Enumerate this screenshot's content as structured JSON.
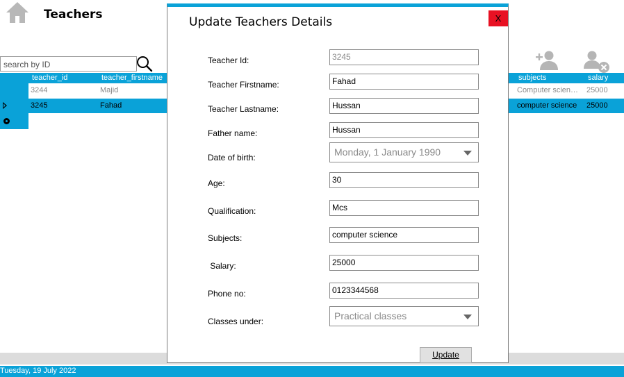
{
  "header": {
    "title": "Teachers",
    "home_icon": "home-icon"
  },
  "search": {
    "placeholder": "search by ID",
    "icon": "search-icon"
  },
  "toolbar": {
    "add_icon": "add-user-icon",
    "remove_icon": "remove-user-icon"
  },
  "grid": {
    "columns": {
      "teacher_id": "teacher_id",
      "teacher_firstname": "teacher_firstname",
      "subjects": "subjects",
      "salary": "salary"
    },
    "rows": [
      {
        "teacher_id": "3244",
        "teacher_firstname": "Majid",
        "subjects": "Computer scien…",
        "salary": "25000"
      },
      {
        "teacher_id": "3245",
        "teacher_firstname": "Fahad",
        "subjects": "computer science",
        "salary": "25000"
      }
    ]
  },
  "status_bar": {
    "date": "Tuesday, 19 July 2022"
  },
  "dialog": {
    "title": "Update Teachers Details",
    "close_label": "X",
    "fields": {
      "teacher_id": {
        "label": "Teacher Id:",
        "value": "3245"
      },
      "first_name": {
        "label": "Teacher Firstname:",
        "value": "Fahad"
      },
      "last_name": {
        "label": "Teacher Lastname:",
        "value": "Hussan"
      },
      "father_name": {
        "label": "Father name:",
        "value": "Hussan"
      },
      "dob": {
        "label": "Date of birth:",
        "value": "Monday, 1 January 1990"
      },
      "age": {
        "label": "Age:",
        "value": "30"
      },
      "qualification": {
        "label": "Qualification:",
        "value": "Mcs"
      },
      "subjects": {
        "label": "Subjects:",
        "value": "computer science"
      },
      "salary": {
        "label": " Salary:",
        "value": "25000"
      },
      "phone": {
        "label": "Phone no:",
        "value": "0123344568"
      },
      "classes": {
        "label": "Classes under:",
        "value": "Practical classes"
      }
    },
    "update_label": "Update"
  },
  "colors": {
    "accent": "#0aa2d8",
    "close": "#e81123"
  }
}
